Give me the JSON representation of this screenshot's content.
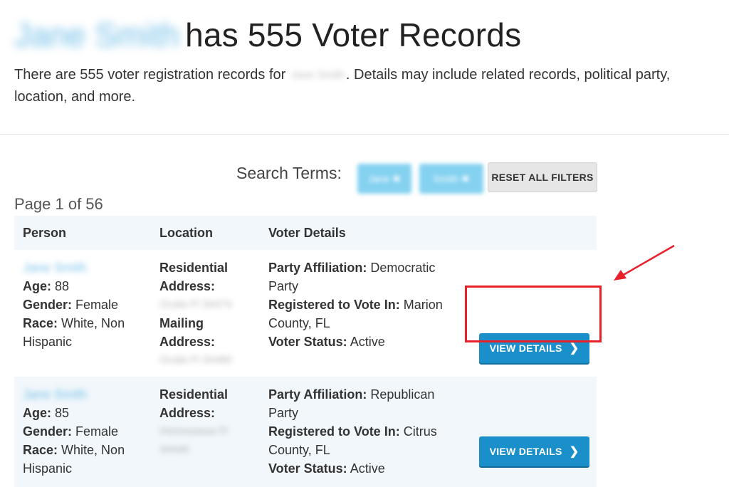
{
  "header": {
    "title_name": "Jane Smith",
    "title_rest": "has 555 Voter Records",
    "lede_before": "There are 555 voter registration records for",
    "lede_name": "Jane Smith",
    "lede_after": ". Details may include related records, political party, location, and more."
  },
  "filters": {
    "label": "Search Terms:",
    "chips": [
      "Jane",
      "Smith"
    ],
    "reset_label": "RESET ALL FILTERS"
  },
  "pagination": {
    "text": "Page 1 of 56"
  },
  "table": {
    "headers": [
      "Person",
      "Location",
      "Voter Details"
    ],
    "rows": [
      {
        "name": "Jane Smith",
        "age_label": "Age:",
        "age": "88",
        "gender_label": "Gender:",
        "gender": "Female",
        "race_label": "Race:",
        "race": "White, Non Hispanic",
        "res_label": "Residential Address:",
        "res_addr": "Ocala Fl 34474",
        "mail_label": "Mailing Address:",
        "mail_addr": "Ocala Fl 34480",
        "party_label": "Party Affiliation:",
        "party": "Democratic Party",
        "reg_label": "Registered to Vote In:",
        "reg": "Marion County, FL",
        "status_label": "Voter Status:",
        "status": "Active",
        "button": "VIEW DETAILS"
      },
      {
        "name": "Jane Smith",
        "age_label": "Age:",
        "age": "85",
        "gender_label": "Gender:",
        "gender": "Female",
        "race_label": "Race:",
        "race": "White, Non Hispanic",
        "res_label": "Residential Address:",
        "res_addr": "Homosassa Fl 34446",
        "party_label": "Party Affiliation:",
        "party": "Republican Party",
        "reg_label": "Registered to Vote In:",
        "reg": "Citrus County, FL",
        "status_label": "Voter Status:",
        "status": "Active",
        "button": "VIEW DETAILS"
      }
    ]
  },
  "annotation": {
    "highlight_color": "#e8202a"
  },
  "colors": {
    "accent": "#1a8fc9",
    "link": "#3fa8df",
    "table_stripe": "#f1f7fb"
  },
  "icons": {
    "button_chevron": "chevron-right-icon",
    "filter_chip": "remove-filter-icon"
  }
}
